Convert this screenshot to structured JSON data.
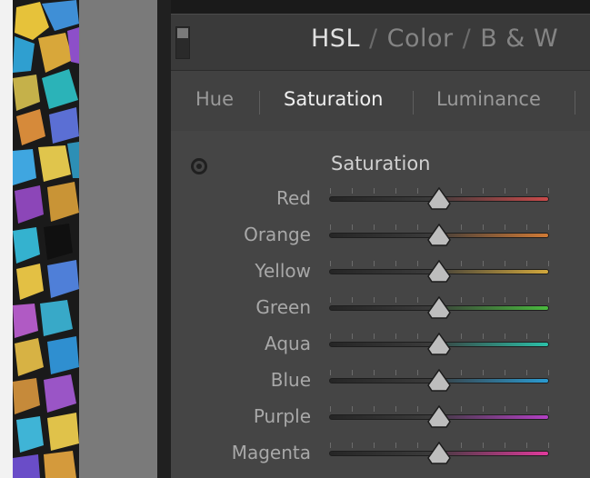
{
  "header": {
    "tabs": [
      {
        "label": "HSL",
        "active": true
      },
      {
        "label": "Color",
        "active": false
      },
      {
        "label": "B & W",
        "active": false
      }
    ],
    "separator": "/"
  },
  "subtabs": [
    {
      "label": "Hue",
      "active": false
    },
    {
      "label": "Saturation",
      "active": true
    },
    {
      "label": "Luminance",
      "active": false
    }
  ],
  "section": {
    "title": "Saturation",
    "target_icon": "target-adjustment-icon"
  },
  "sliders": [
    {
      "label": "Red",
      "value": 0,
      "color": "#c94a4a"
    },
    {
      "label": "Orange",
      "value": 0,
      "color": "#d07a35"
    },
    {
      "label": "Yellow",
      "value": 0,
      "color": "#d2a83c"
    },
    {
      "label": "Green",
      "value": 0,
      "color": "#4aba3e"
    },
    {
      "label": "Aqua",
      "value": 0,
      "color": "#2bc0a8"
    },
    {
      "label": "Blue",
      "value": 0,
      "color": "#2a9bd2"
    },
    {
      "label": "Purple",
      "value": 0,
      "color": "#b340c4"
    },
    {
      "label": "Magenta",
      "value": 0,
      "color": "#e03a9c"
    }
  ],
  "slider_range": [
    -100,
    100
  ],
  "colors": {
    "panel_bg": "#454545",
    "header_bg": "#3a3a3a",
    "text_active": "#f0f0f0",
    "text_muted": "#9a9a9a"
  }
}
